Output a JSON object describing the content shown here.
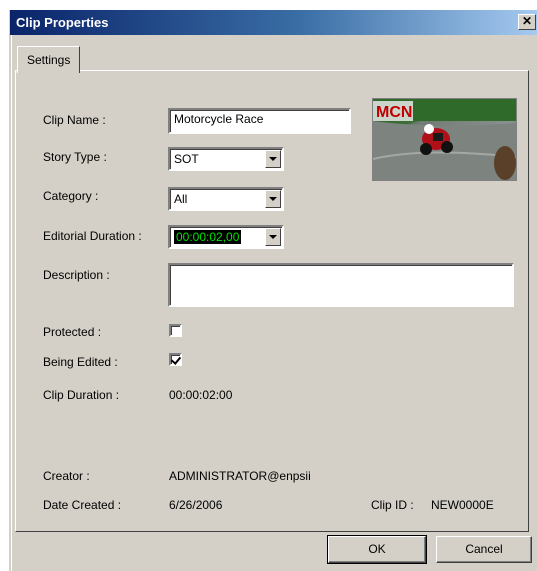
{
  "window": {
    "title": "Clip Properties",
    "close_glyph": "✕"
  },
  "tabs": [
    {
      "label": "Settings"
    }
  ],
  "form": {
    "clip_name_label": "Clip Name :",
    "clip_name_value": "Motorcycle Race",
    "story_type_label": "Story Type :",
    "story_type_value": "SOT",
    "category_label": "Category :",
    "category_value": "All",
    "editorial_duration_label": "Editorial Duration :",
    "editorial_duration_value": "00:00:02,00",
    "description_label": "Description :",
    "description_value": "",
    "protected_label": "Protected :",
    "protected_checked": false,
    "being_edited_label": "Being Edited :",
    "being_edited_checked": true,
    "clip_duration_label": "Clip Duration :",
    "clip_duration_value": "00:00:02:00",
    "creator_label": "Creator :",
    "creator_value": "ADMINISTRATOR@enpsii",
    "date_created_label": "Date Created :",
    "date_created_value": "6/26/2006",
    "clip_id_label": "Clip ID :",
    "clip_id_value": "NEW0000E"
  },
  "thumbnail": {
    "overlay_text": "MCN"
  },
  "buttons": {
    "ok": "OK",
    "cancel": "Cancel"
  },
  "colors": {
    "title_bar": "#0a246a",
    "duration_fg": "#00e000",
    "duration_bg": "#000000"
  }
}
